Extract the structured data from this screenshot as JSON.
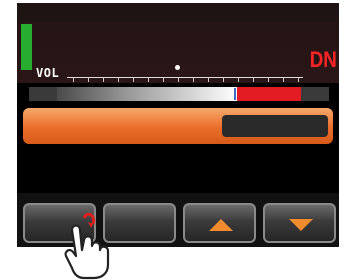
{
  "display": {
    "vol_label": "VOL",
    "direction_label": "DN",
    "level_meter_color": "#27ad2f",
    "accent_color": "#ff2326"
  },
  "controls": {
    "buttons": [
      {
        "name": "function-button-1",
        "icon": "touching-hand-icon"
      },
      {
        "name": "function-button-2",
        "icon": ""
      },
      {
        "name": "up-button",
        "icon": "arrow-up-icon"
      },
      {
        "name": "down-button",
        "icon": "arrow-down-icon"
      }
    ],
    "arrow_color": "#f28a2e"
  }
}
